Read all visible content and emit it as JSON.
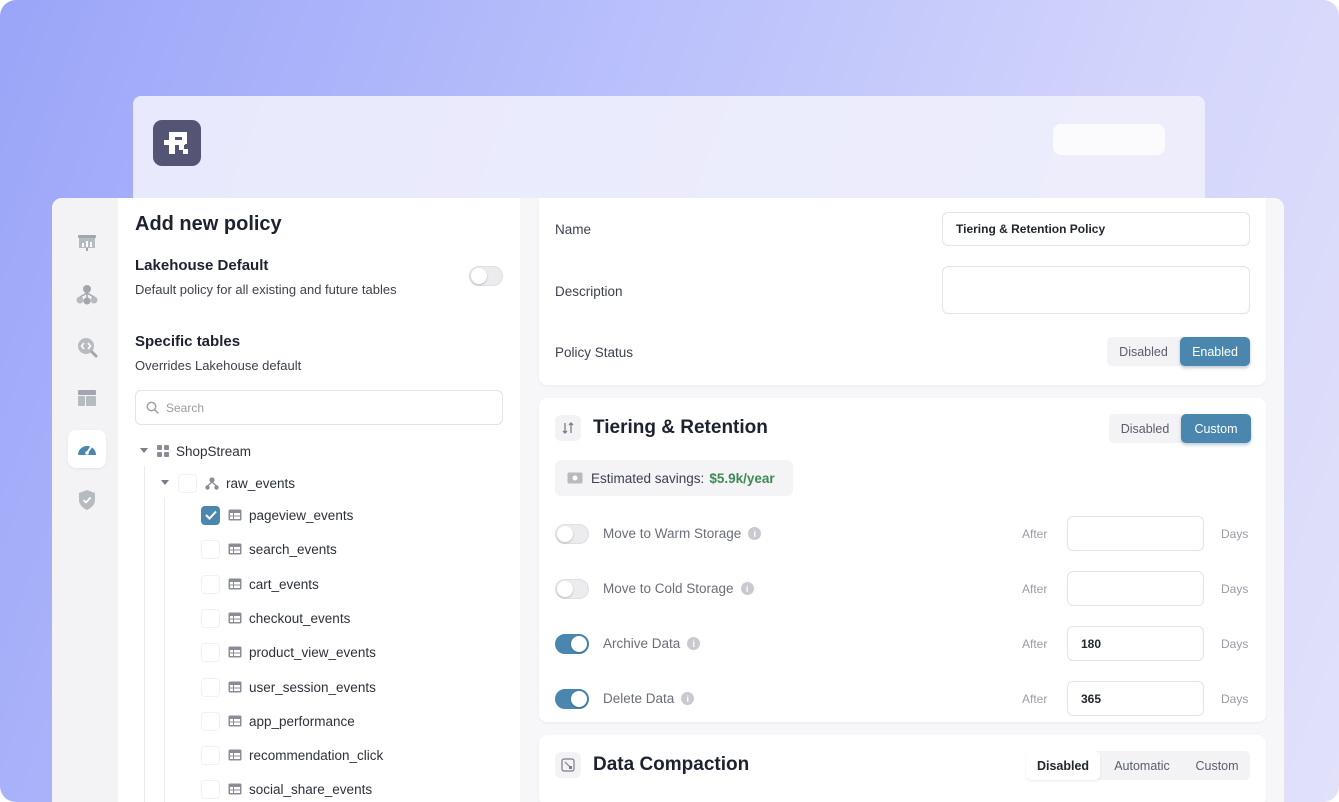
{
  "app": {
    "logo_icon": "brand-logo-icon"
  },
  "rail": {
    "items": [
      {
        "icon": "dashboard-chart-icon",
        "active": false
      },
      {
        "icon": "pipeline-tree-icon",
        "active": false
      },
      {
        "icon": "code-search-icon",
        "active": false
      },
      {
        "icon": "table-layout-icon",
        "active": false
      },
      {
        "icon": "gauge-icon",
        "active": true
      },
      {
        "icon": "shield-check-icon",
        "active": false
      }
    ]
  },
  "left": {
    "title": "Add new policy",
    "lakehouse_default": {
      "title": "Lakehouse Default",
      "subtitle": "Default policy for all existing and future tables",
      "enabled": false
    },
    "specific_tables": {
      "title": "Specific tables",
      "subtitle": "Overrides Lakehouse default"
    },
    "search": {
      "placeholder": "Search",
      "value": ""
    },
    "tree": {
      "root": {
        "label": "ShopStream",
        "expanded": true
      },
      "group": {
        "label": "raw_events",
        "expanded": true
      },
      "tables": [
        {
          "label": "pageview_events",
          "checked": true
        },
        {
          "label": "search_events",
          "checked": false
        },
        {
          "label": "cart_events",
          "checked": false
        },
        {
          "label": "checkout_events",
          "checked": false
        },
        {
          "label": "product_view_events",
          "checked": false
        },
        {
          "label": "user_session_events",
          "checked": false
        },
        {
          "label": "app_performance",
          "checked": false
        },
        {
          "label": "recommendation_click",
          "checked": false
        },
        {
          "label": "social_share_events",
          "checked": false
        }
      ]
    }
  },
  "general": {
    "name_label": "Name",
    "name_value": "Tiering & Retention Policy",
    "description_label": "Description",
    "description_value": "",
    "status_label": "Policy Status",
    "status_options": [
      "Disabled",
      "Enabled"
    ],
    "status_selected": "Enabled"
  },
  "tiering": {
    "title": "Tiering & Retention",
    "mode_options": [
      "Disabled",
      "Custom"
    ],
    "mode_selected": "Custom",
    "savings_label": "Estimated savings:",
    "savings_value": "$5.9k/year",
    "after_label": "After",
    "days_label": "Days",
    "rules": [
      {
        "label": "Move to Warm Storage",
        "enabled": false,
        "value": ""
      },
      {
        "label": "Move to Cold Storage",
        "enabled": false,
        "value": ""
      },
      {
        "label": "Archive Data",
        "enabled": true,
        "value": "180"
      },
      {
        "label": "Delete Data",
        "enabled": true,
        "value": "365"
      }
    ]
  },
  "compaction": {
    "title": "Data Compaction",
    "mode_options": [
      "Disabled",
      "Automatic",
      "Custom"
    ],
    "mode_selected": "Disabled"
  },
  "colors": {
    "accent": "#4a86ae",
    "savings_green": "#3f8a54",
    "logo_bg": "#545475"
  }
}
